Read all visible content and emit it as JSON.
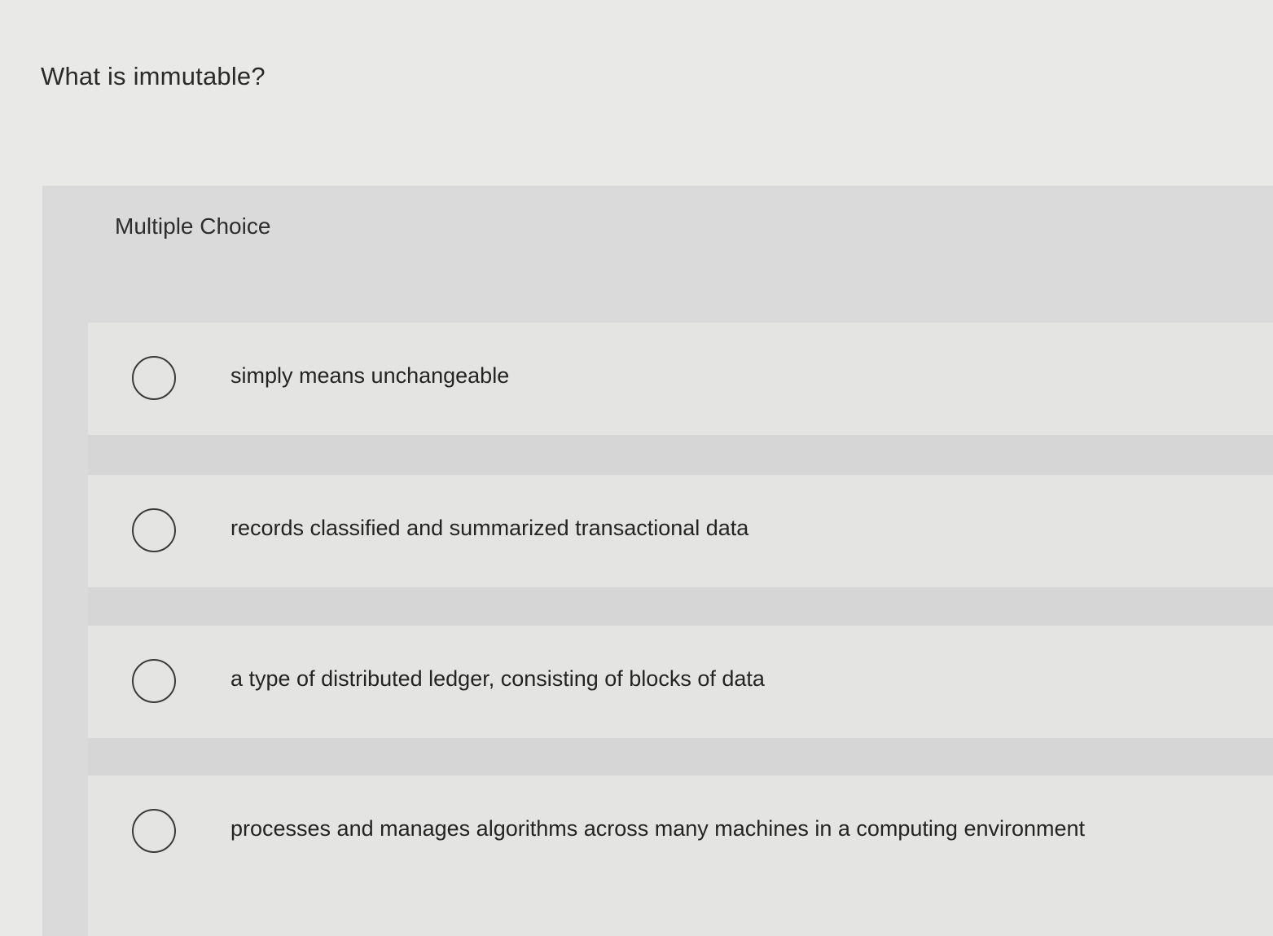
{
  "question": {
    "text": "What is immutable?"
  },
  "panel": {
    "label": "Multiple Choice"
  },
  "options": [
    {
      "label": "simply means unchangeable",
      "selected": false
    },
    {
      "label": "records classified and summarized transactional data",
      "selected": false
    },
    {
      "label": "a type of distributed ledger, consisting of blocks of data",
      "selected": false
    },
    {
      "label": "processes and manages algorithms across many machines in a computing environment",
      "selected": false
    }
  ]
}
